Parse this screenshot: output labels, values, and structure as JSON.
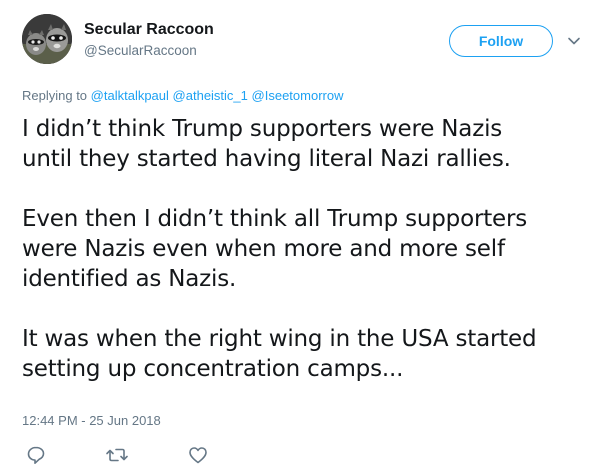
{
  "user": {
    "display_name": "Secular Raccoon",
    "screen_name": "@SecularRaccoon"
  },
  "follow_label": "Follow",
  "replying": {
    "prefix": "Replying to",
    "mentions": [
      "@talktalkpaul",
      "@atheistic_1",
      "@Iseetomorrow"
    ]
  },
  "tweet": {
    "paragraphs": [
      {
        "lines": [
          "I didn’t think Trump supporters were Nazis",
          "until they started having literal Nazi rallies."
        ]
      },
      {
        "lines": [
          "Even then I didn’t think all Trump supporters",
          "were Nazis even when more and more self",
          "identified as Nazis."
        ]
      },
      {
        "lines": [
          "It was when the right wing in the USA started",
          "setting up concentration camps..."
        ]
      }
    ],
    "timestamp": "12:44 PM - 25 Jun 2018"
  },
  "actions": [
    {
      "name": "reply-icon"
    },
    {
      "name": "retweet-icon"
    },
    {
      "name": "like-icon"
    }
  ],
  "colors": {
    "accent": "#1da1f2",
    "text": "#14171a",
    "secondary": "#657786"
  }
}
